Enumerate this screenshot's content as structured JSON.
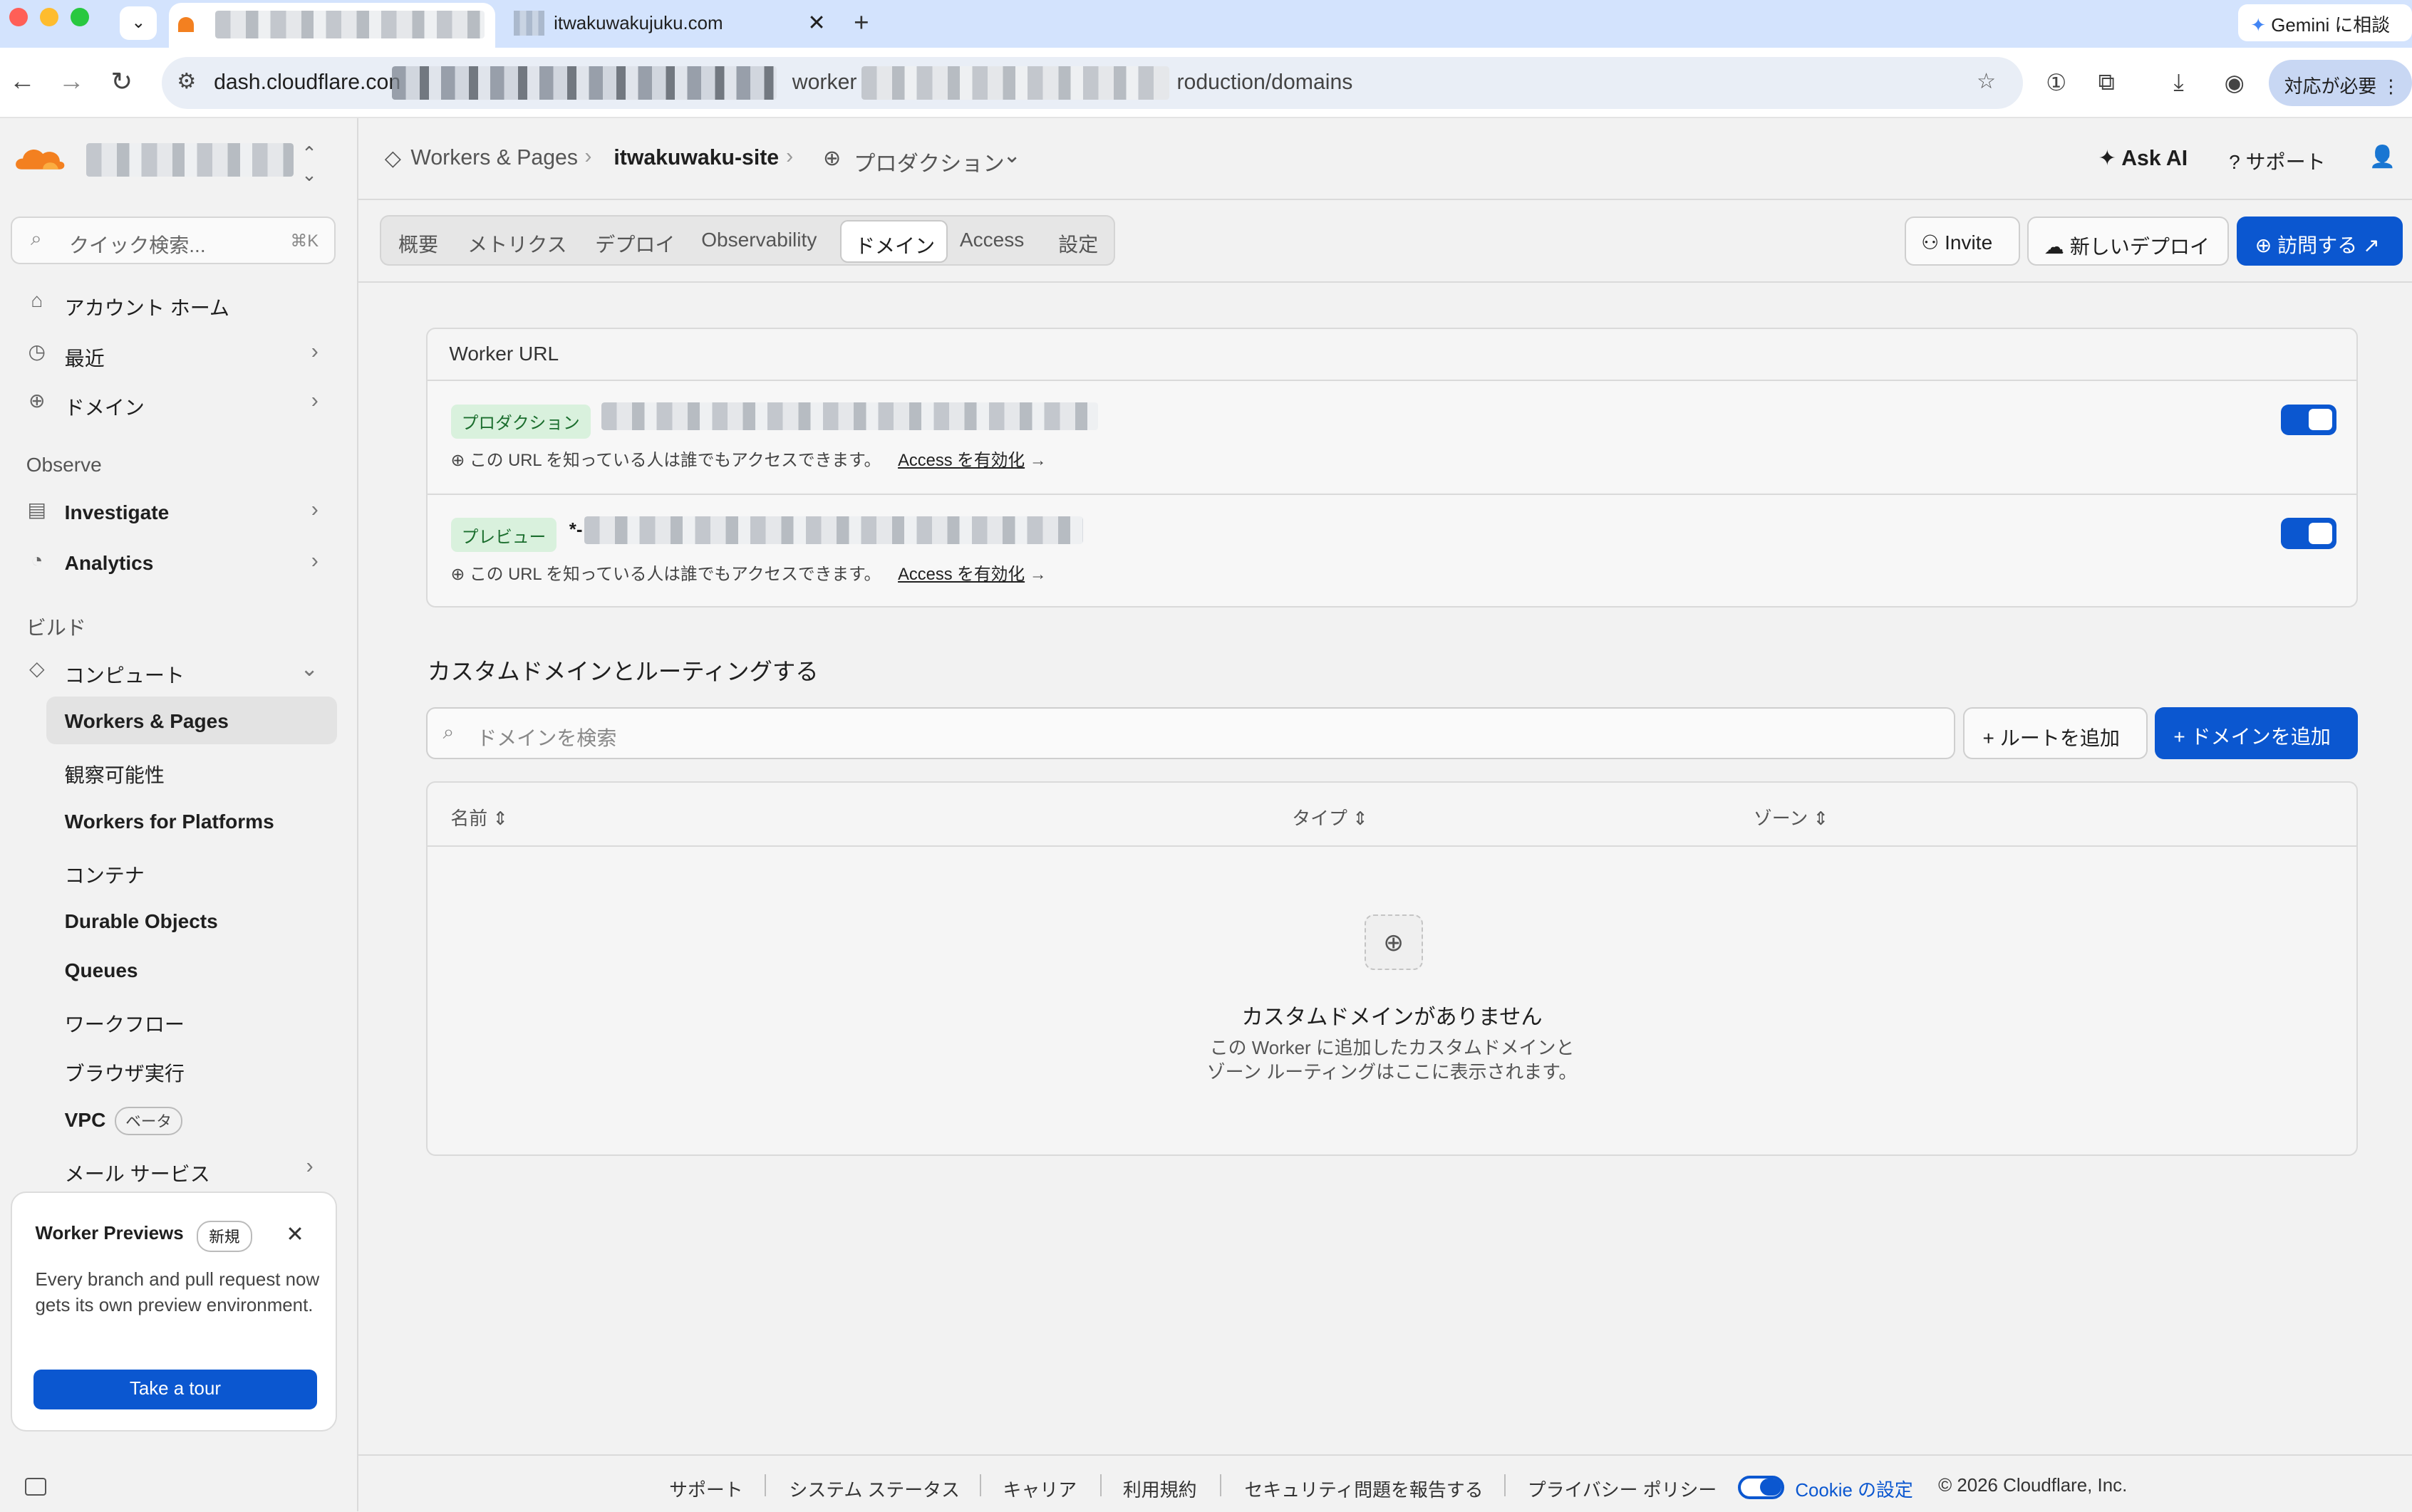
{
  "browser": {
    "active_tab_title": "",
    "inactive_tab_title": "itwakuwakujuku.com",
    "url_visible": "dash.cloudflare.con",
    "url_tail": "roduction/domains",
    "url_mid": "worker",
    "gemini_label": "Gemini に相談",
    "taiou_label": "対応が必要"
  },
  "sidebar": {
    "quick_search_placeholder": "クイック検索...",
    "quick_search_shortcut": "⌘K",
    "nav": [
      {
        "label": "アカウント ホーム"
      },
      {
        "label": "最近"
      },
      {
        "label": "ドメイン"
      }
    ],
    "observe_title": "Observe",
    "observe": [
      {
        "label": "Investigate"
      },
      {
        "label": "Analytics"
      }
    ],
    "build_title": "ビルド",
    "compute_label": "コンピュート",
    "compute_items": [
      {
        "label": "Workers & Pages"
      },
      {
        "label": "観察可能性"
      },
      {
        "label": "Workers for Platforms"
      },
      {
        "label": "コンテナ"
      },
      {
        "label": "Durable Objects"
      },
      {
        "label": "Queues"
      },
      {
        "label": "ワークフロー"
      },
      {
        "label": "ブラウザ実行"
      },
      {
        "label": "VPC",
        "badge": "ベータ"
      },
      {
        "label": "メール サービス"
      }
    ],
    "promo": {
      "title": "Worker Previews",
      "badge": "新規",
      "body": "Every branch and pull request now gets its own preview environment.",
      "button": "Take a tour"
    }
  },
  "header": {
    "breadcrumb": {
      "root": "Workers & Pages",
      "project": "itwakuwaku-site",
      "env": "プロダクション"
    },
    "ask_ai": "Ask AI",
    "support": "サポート"
  },
  "tabs": [
    "概要",
    "メトリクス",
    "デプロイ",
    "Observability",
    "ドメイン",
    "Access",
    "設定"
  ],
  "actions": {
    "invite": "Invite",
    "new_deploy": "新しいデプロイ",
    "visit": "訪問する"
  },
  "worker_url": {
    "title": "Worker URL",
    "rows": [
      {
        "env": "プロダクション",
        "prefix": "",
        "note": "この URL を知っている人は誰でもアクセスできます。",
        "access_link": "Access を有効化",
        "enabled": true
      },
      {
        "env": "プレビュー",
        "prefix": "*-",
        "note": "この URL を知っている人は誰でもアクセスできます。",
        "access_link": "Access を有効化",
        "enabled": true
      }
    ]
  },
  "custom_domains": {
    "title": "カスタムドメインとルーティングする",
    "search_placeholder": "ドメインを検索",
    "add_route": "ルートを追加",
    "add_domain": "ドメインを追加",
    "columns": [
      "名前",
      "タイプ",
      "ゾーン"
    ],
    "empty_title": "カスタムドメインがありません",
    "empty_line1": "この Worker に追加したカスタムドメインと",
    "empty_line2": "ゾーン ルーティングはここに表示されます。"
  },
  "footer": {
    "links": [
      "サポート",
      "システム ステータス",
      "キャリア",
      "利用規約",
      "セキュリティ問題を報告する",
      "プライバシー ポリシー"
    ],
    "cookie": "Cookie の設定",
    "copyright": "© 2026 Cloudflare, Inc."
  },
  "colors": {
    "accent": "#0b57d0",
    "brand_orange": "#f38020",
    "badge_green_bg": "#d9f1dd"
  }
}
